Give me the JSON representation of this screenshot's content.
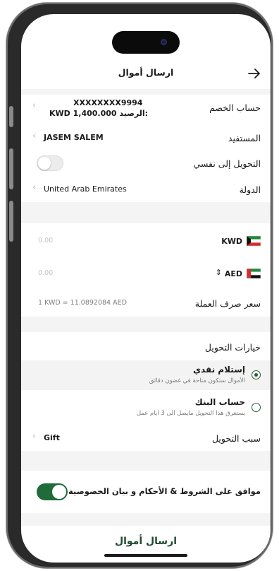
{
  "header": {
    "title": "ارسال أموال",
    "back_icon": "arrow-right-icon"
  },
  "debit_account": {
    "label": "حساب الخصم",
    "account_number": "XXXXXXXX9994",
    "balance_label": "الرصيد:",
    "balance_value": "KWD 1,400.000"
  },
  "beneficiary": {
    "label": "المستفيد",
    "value": "JASEM SALEM"
  },
  "self_transfer": {
    "label": "التحويل إلى نفسي",
    "enabled": false
  },
  "country": {
    "label": "الدولة",
    "value": "United Arab Emirates"
  },
  "amounts": {
    "from": {
      "currency": "KWD",
      "amount_placeholder": "0.00"
    },
    "to": {
      "currency": "AED",
      "amount_placeholder": "0.00"
    }
  },
  "exchange_rate": {
    "label": "سعر صرف العملة",
    "value": "1 KWD = 11.0892084 AED"
  },
  "transfer_options": {
    "title": "خيارات التحويل",
    "options": [
      {
        "title": "إستلام نقدي",
        "subtitle": "الأموال ستكون متاحة في غضون دقائق",
        "selected": true
      },
      {
        "title": "حساب البنك",
        "subtitle": "يستغرق هذا التحويل مايصل الى 3 ايام عمل",
        "selected": false
      }
    ]
  },
  "transfer_reason": {
    "label": "سبب التحويل",
    "value": "Gift"
  },
  "terms": {
    "label": "موافق على الشروط & الأحكام و بيان الخصوصية",
    "accepted": true
  },
  "submit": {
    "label": "ارسال أموال"
  },
  "colors": {
    "accent_green": "#1f6b3a",
    "divider_grey": "#f4f4f4"
  }
}
